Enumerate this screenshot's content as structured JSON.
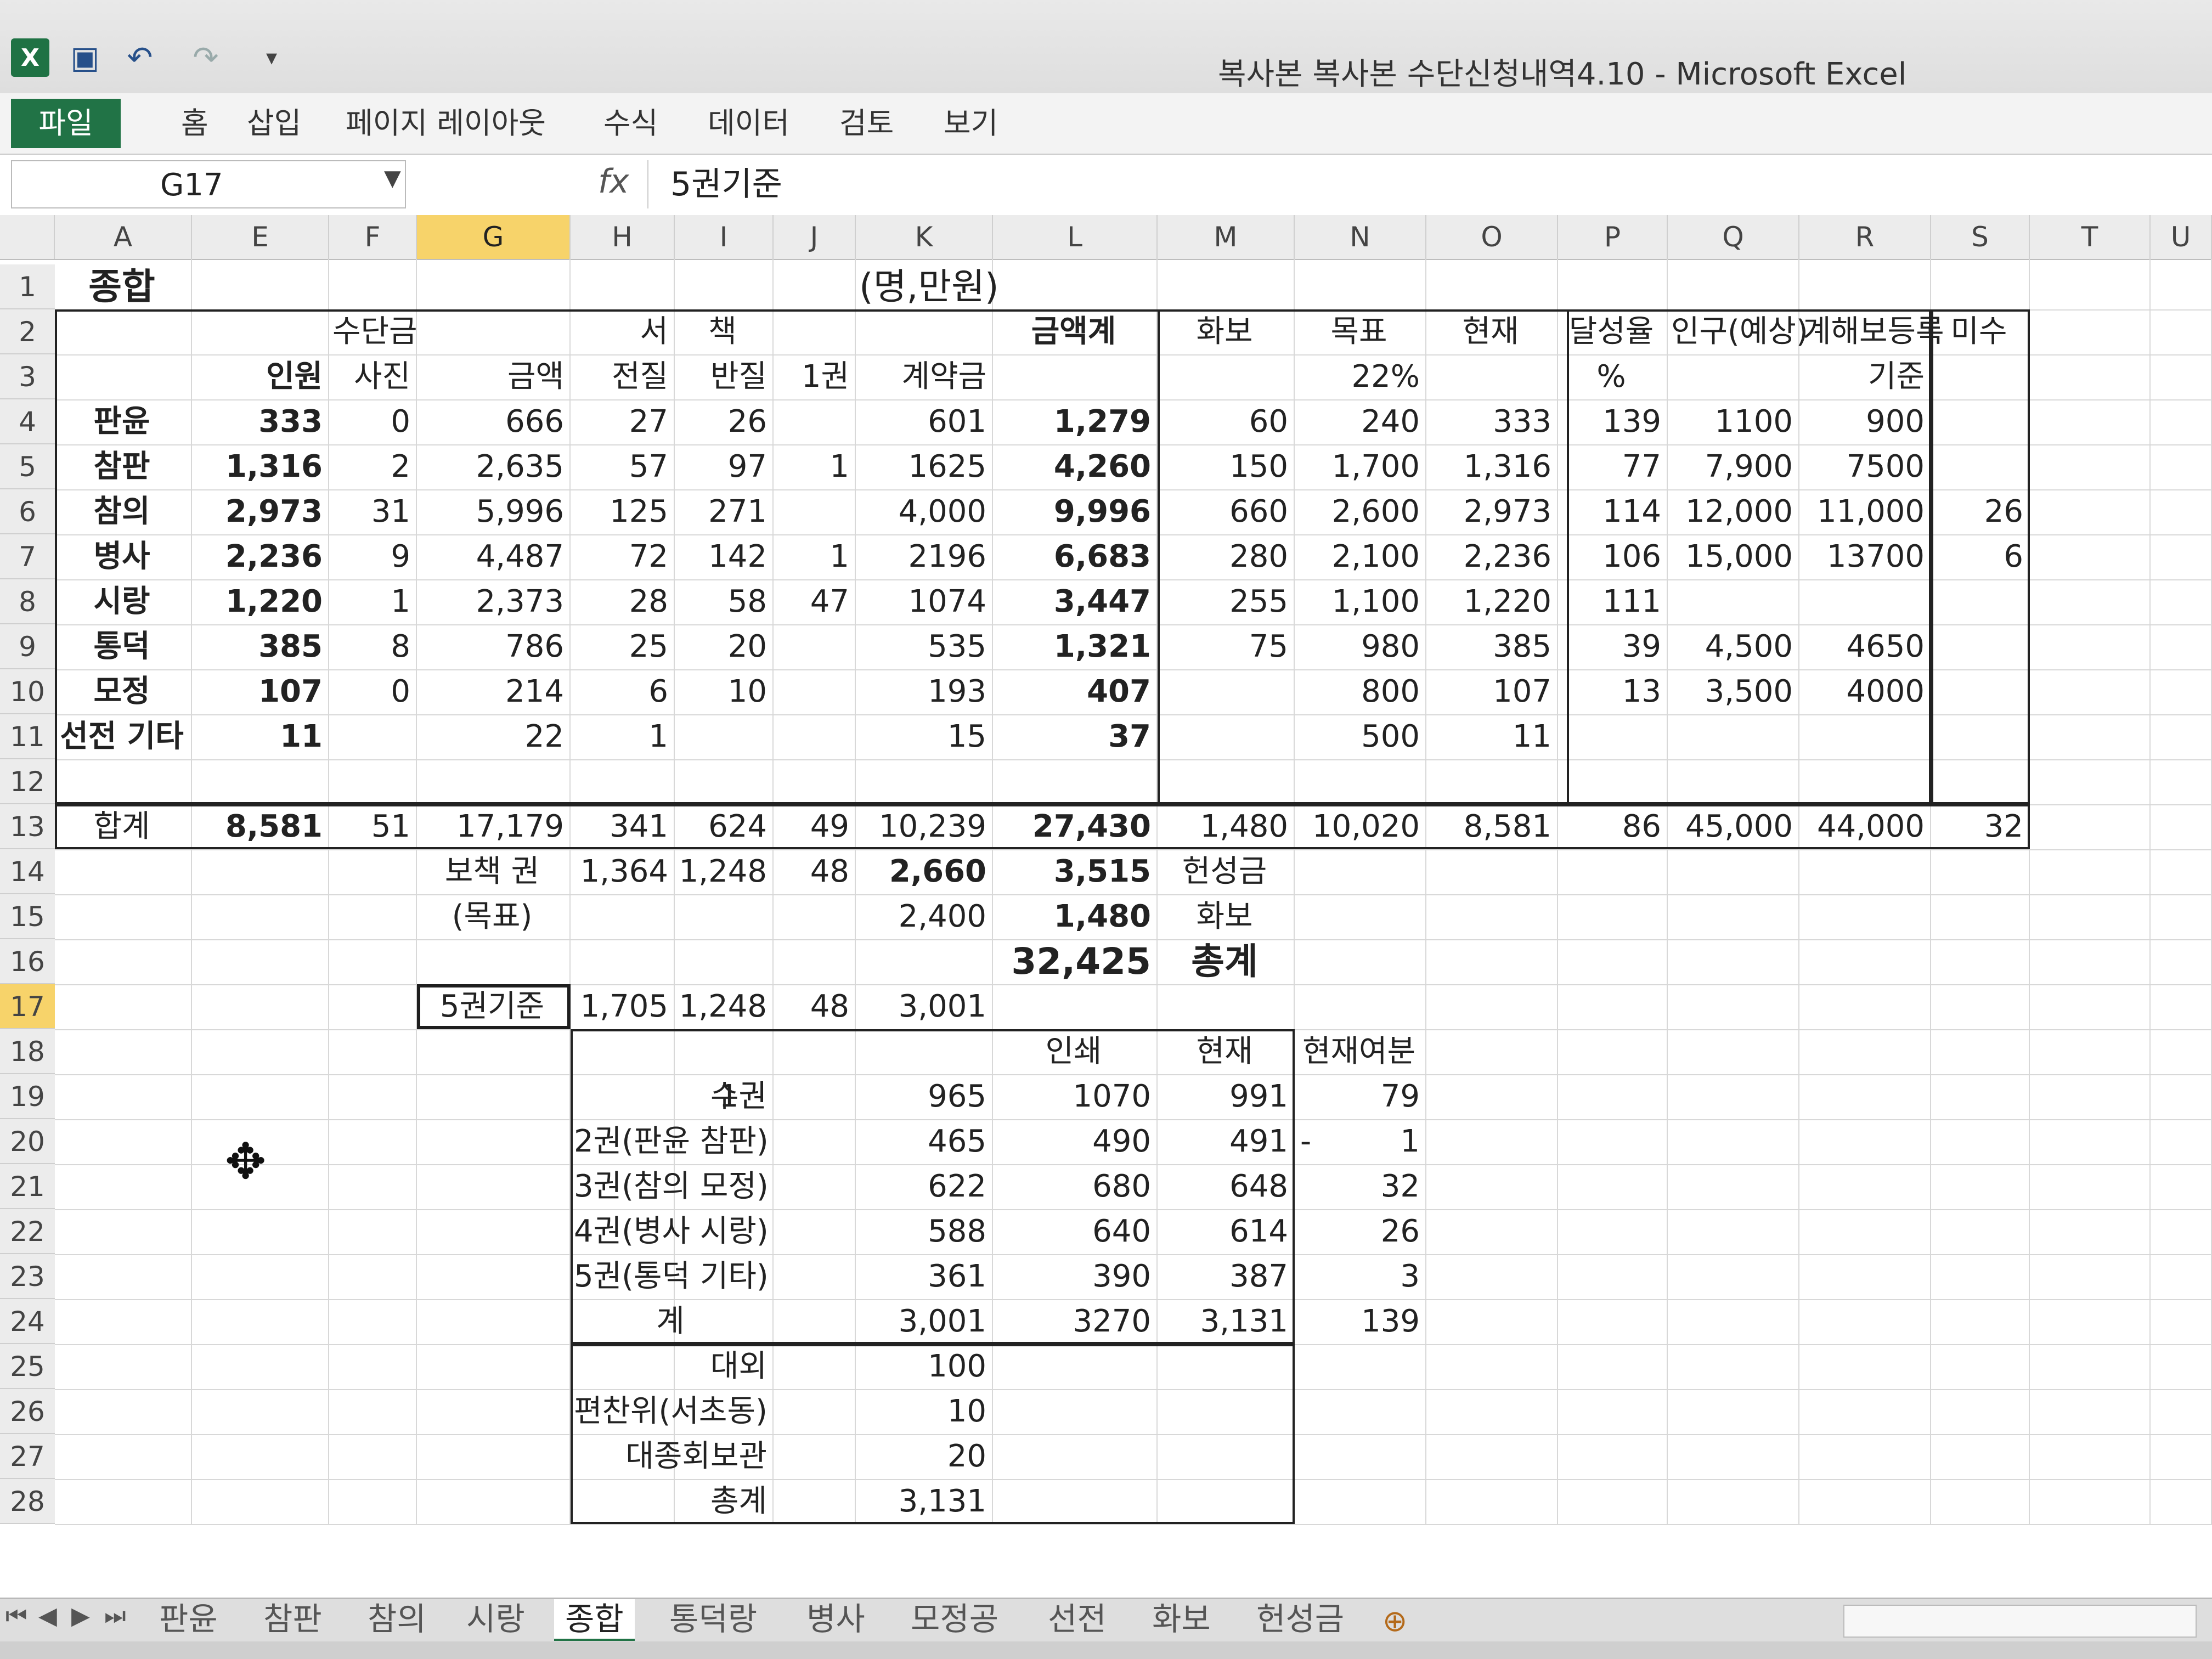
{
  "window": {
    "title": "복사본 복사본 수단신청내역4.10 - Microsoft Excel"
  },
  "ribbon": {
    "tabs": [
      "파일",
      "홈",
      "삽입",
      "페이지 레이아웃",
      "수식",
      "데이터",
      "검토",
      "보기"
    ]
  },
  "formula_bar": {
    "name_box": "G17",
    "content": "5권기준"
  },
  "columns": [
    "A",
    "E",
    "F",
    "G",
    "H",
    "I",
    "J",
    "K",
    "L",
    "M",
    "N",
    "O",
    "P",
    "Q",
    "R",
    "S",
    "T",
    "U"
  ],
  "rows": [
    "1",
    "2",
    "3",
    "4",
    "5",
    "6",
    "7",
    "8",
    "9",
    "10",
    "11",
    "12",
    "13",
    "14",
    "15",
    "16",
    "17",
    "18",
    "19",
    "20",
    "21",
    "22",
    "23",
    "24",
    "25",
    "26",
    "27",
    "28"
  ],
  "sheet": {
    "r1": {
      "a": "종합",
      "k": "(명,만원)"
    },
    "r2": {
      "f": "수단금",
      "h": "서",
      "i": "책",
      "l": "금액계",
      "m": "화보",
      "n": "목표",
      "o": "현재",
      "p": "달성율",
      "q": "인구(예상)",
      "r": "계해보등록",
      "s": "미수"
    },
    "r3": {
      "e": "인원",
      "f": "사진",
      "g": "금액",
      "h": "전질",
      "i": "반질",
      "j": "1권",
      "k": "계약금",
      "n": "22%",
      "p": "%",
      "r": "기준"
    },
    "data_rows": [
      {
        "a": "판윤",
        "e": "333",
        "f": "0",
        "g": "666",
        "h": "27",
        "i": "26",
        "j": "",
        "k": "601",
        "l": "1,279",
        "m": "60",
        "n": "240",
        "o": "333",
        "p": "139",
        "q": "1100",
        "r": "900",
        "s": ""
      },
      {
        "a": "참판",
        "e": "1,316",
        "f": "2",
        "g": "2,635",
        "h": "57",
        "i": "97",
        "j": "1",
        "k": "1625",
        "l": "4,260",
        "m": "150",
        "n": "1,700",
        "o": "1,316",
        "p": "77",
        "q": "7,900",
        "r": "7500",
        "s": ""
      },
      {
        "a": "참의",
        "e": "2,973",
        "f": "31",
        "g": "5,996",
        "h": "125",
        "i": "271",
        "j": "",
        "k": "4,000",
        "l": "9,996",
        "m": "660",
        "n": "2,600",
        "o": "2,973",
        "p": "114",
        "q": "12,000",
        "r": "11,000",
        "s": "26"
      },
      {
        "a": "병사",
        "e": "2,236",
        "f": "9",
        "g": "4,487",
        "h": "72",
        "i": "142",
        "j": "1",
        "k": "2196",
        "l": "6,683",
        "m": "280",
        "n": "2,100",
        "o": "2,236",
        "p": "106",
        "q": "15,000",
        "r": "13700",
        "s": "6"
      },
      {
        "a": "시랑",
        "e": "1,220",
        "f": "1",
        "g": "2,373",
        "h": "28",
        "i": "58",
        "j": "47",
        "k": "1074",
        "l": "3,447",
        "m": "255",
        "n": "1,100",
        "o": "1,220",
        "p": "111",
        "q": "",
        "r": "",
        "s": ""
      },
      {
        "a": "통덕",
        "e": "385",
        "f": "8",
        "g": "786",
        "h": "25",
        "i": "20",
        "j": "",
        "k": "535",
        "l": "1,321",
        "m": "75",
        "n": "980",
        "o": "385",
        "p": "39",
        "q": "4,500",
        "r": "4650",
        "s": ""
      },
      {
        "a": "모정",
        "e": "107",
        "f": "0",
        "g": "214",
        "h": "6",
        "i": "10",
        "j": "",
        "k": "193",
        "l": "407",
        "m": "",
        "n": "800",
        "o": "107",
        "p": "13",
        "q": "3,500",
        "r": "4000",
        "s": ""
      },
      {
        "a": "선전 기타",
        "e": "11",
        "f": "",
        "g": "22",
        "h": "1",
        "i": "",
        "j": "",
        "k": "15",
        "l": "37",
        "m": "",
        "n": "500",
        "o": "11",
        "p": "",
        "q": "",
        "r": "",
        "s": ""
      }
    ],
    "r13": {
      "a": "합계",
      "e": "8,581",
      "f": "51",
      "g": "17,179",
      "h": "341",
      "i": "624",
      "j": "49",
      "k": "10,239",
      "l": "27,430",
      "m": "1,480",
      "n": "10,020",
      "o": "8,581",
      "p": "86",
      "q": "45,000",
      "r": "44,000",
      "s": "32"
    },
    "r14": {
      "g": "보책 권",
      "h": "1,364",
      "i": "1,248",
      "j": "48",
      "k": "2,660",
      "l": "3,515",
      "m": "헌성금"
    },
    "r15": {
      "g": "(목표)",
      "k": "2,400",
      "l": "1,480",
      "m": "화보"
    },
    "r16": {
      "l": "32,425",
      "m": "총계"
    },
    "r17": {
      "g": "5권기준",
      "h": "1,705",
      "i": "1,248",
      "j": "48",
      "k": "3,001"
    },
    "r18": {
      "l": "인쇄",
      "m": "현재",
      "n": "현재여분"
    },
    "vol_rows": [
      {
        "h": "1권",
        "i": "수권",
        "k": "965",
        "l": "1070",
        "m": "991",
        "n": "79"
      },
      {
        "h": "2권(판윤 참판)",
        "i": "",
        "k": "465",
        "l": "490",
        "m": "491",
        "n": "1"
      },
      {
        "h": "3권(참의 모정)",
        "i": "",
        "k": "622",
        "l": "680",
        "m": "648",
        "n": "32"
      },
      {
        "h": "4권(병사 시랑)",
        "i": "",
        "k": "588",
        "l": "640",
        "m": "614",
        "n": "26"
      },
      {
        "h": "5권(통덕 기타)",
        "i": "",
        "k": "361",
        "l": "390",
        "m": "387",
        "n": "3"
      },
      {
        "h": "계",
        "i": "",
        "k": "3,001",
        "l": "3270",
        "m": "3,131",
        "n": "139"
      }
    ],
    "r20_neg": "-",
    "extra_rows": [
      {
        "h": "대외",
        "k": "100"
      },
      {
        "h": "편찬위(서초동)",
        "k": "10"
      },
      {
        "h": "대종회보관",
        "k": "20"
      },
      {
        "h": "총계",
        "k": "3,131"
      }
    ]
  },
  "sheet_tabs": [
    "판윤",
    "참판",
    "참의",
    "시랑",
    "종합",
    "통덕랑",
    "병사",
    "모정공",
    "선전",
    "화보",
    "헌성금"
  ],
  "active_sheet": "종합",
  "colors": {
    "excel_green": "#217346",
    "selected_header": "#f7d36a"
  }
}
